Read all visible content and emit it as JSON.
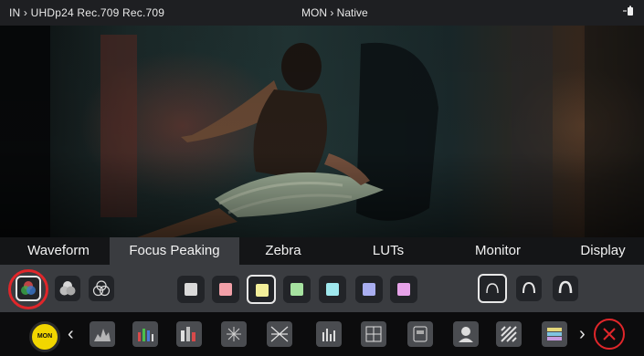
{
  "status_bar": {
    "input_label": "IN › UHDp24 Rec.709 Rec.709",
    "monitor_label": "MON › Native",
    "battery_icon": "battery-icon"
  },
  "tabs": [
    {
      "label": "Waveform"
    },
    {
      "label": "Focus Peaking",
      "active": true
    },
    {
      "label": "Zebra"
    },
    {
      "label": "LUTs"
    },
    {
      "label": "Monitor"
    },
    {
      "label": "Display"
    }
  ],
  "focus_peaking": {
    "mode_icons": [
      "rgb-peaking-icon",
      "mono-filled-peaking-icon",
      "mono-outline-peaking-icon"
    ],
    "selected_mode": 0,
    "colors": [
      "#d9d9d9",
      "#f2a0a8",
      "#f3ef9a",
      "#a6e2a0",
      "#9fe8ee",
      "#a9aef0",
      "#e7a3e9"
    ],
    "selected_color": 2,
    "sensitivity_icons": [
      "low-sensitivity-arc-icon",
      "medium-sensitivity-arc-icon",
      "high-sensitivity-arc-icon"
    ],
    "selected_sensitivity": 0
  },
  "toolbar": {
    "mon_label": "MON",
    "tools": [
      "waveform-luma-icon",
      "waveform-rgb-icon",
      "waveform-parade-icon",
      "vectorscope-icon",
      "vectorscope-zoom-icon",
      "audio-meters-icon",
      "false-color-icon",
      "guides-icon",
      "focus-assist-icon",
      "zebra-icon",
      "color-bars-icon"
    ],
    "close_icon": "close-icon"
  },
  "colors": {
    "accent_yellow": "#f2d600",
    "close_red": "#e0262a",
    "panel_grey": "#3a3c40"
  }
}
